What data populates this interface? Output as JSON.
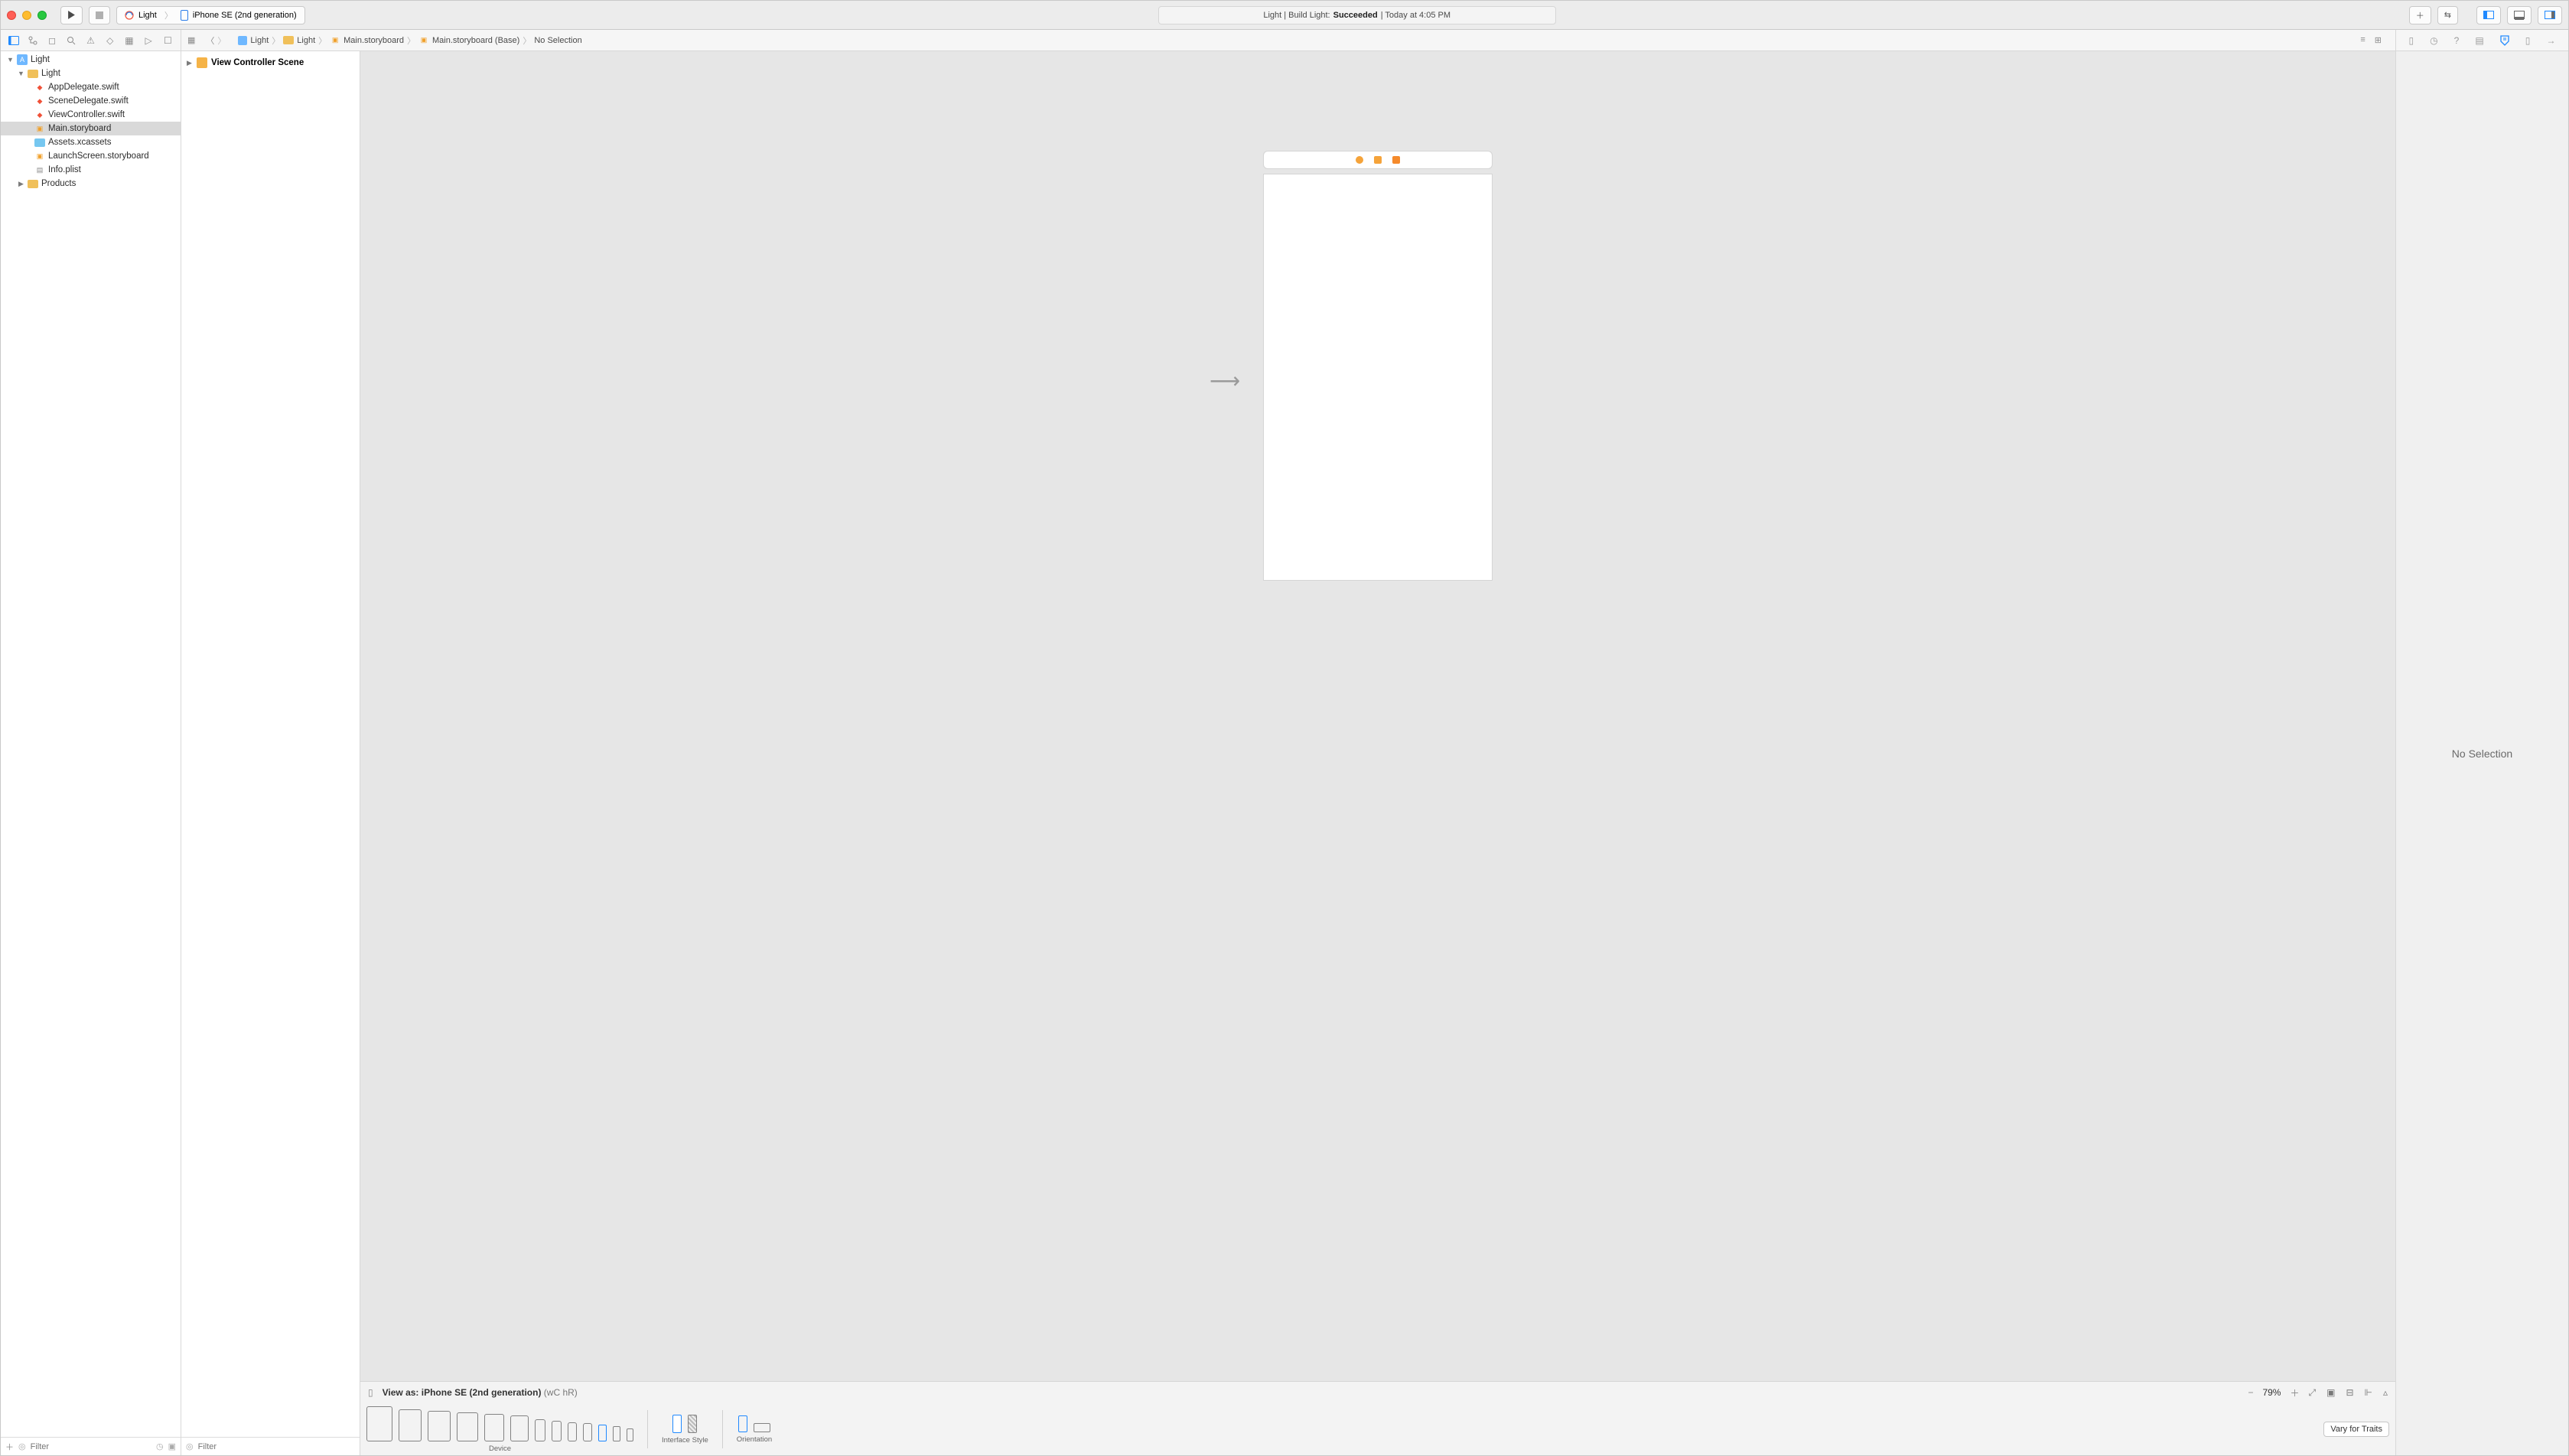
{
  "titlebar": {
    "scheme_target": "Light",
    "scheme_device": "iPhone SE (2nd generation)",
    "status_prefix": "Light | Build Light:",
    "status_result": "Succeeded",
    "status_time": "| Today at 4:05 PM"
  },
  "navigator": {
    "filter_placeholder": "Filter",
    "tree": {
      "project": "Light",
      "group": "Light",
      "files": [
        "AppDelegate.swift",
        "SceneDelegate.swift",
        "ViewController.swift",
        "Main.storyboard",
        "Assets.xcassets",
        "LaunchScreen.storyboard",
        "Info.plist"
      ],
      "products": "Products"
    }
  },
  "jumpbar": {
    "items": [
      "Light",
      "Light",
      "Main.storyboard",
      "Main.storyboard (Base)",
      "No Selection"
    ]
  },
  "outline": {
    "scene": "View Controller Scene",
    "filter_placeholder": "Filter"
  },
  "device_bar": {
    "view_as_prefix": "View as:",
    "view_as_device": "iPhone SE (2nd generation)",
    "traits": "(wC hR)",
    "zoom": "79%",
    "labels": {
      "device": "Device",
      "interface_style": "Interface Style",
      "orientation": "Orientation"
    },
    "vary": "Vary for Traits"
  },
  "inspector": {
    "no_selection": "No Selection"
  }
}
